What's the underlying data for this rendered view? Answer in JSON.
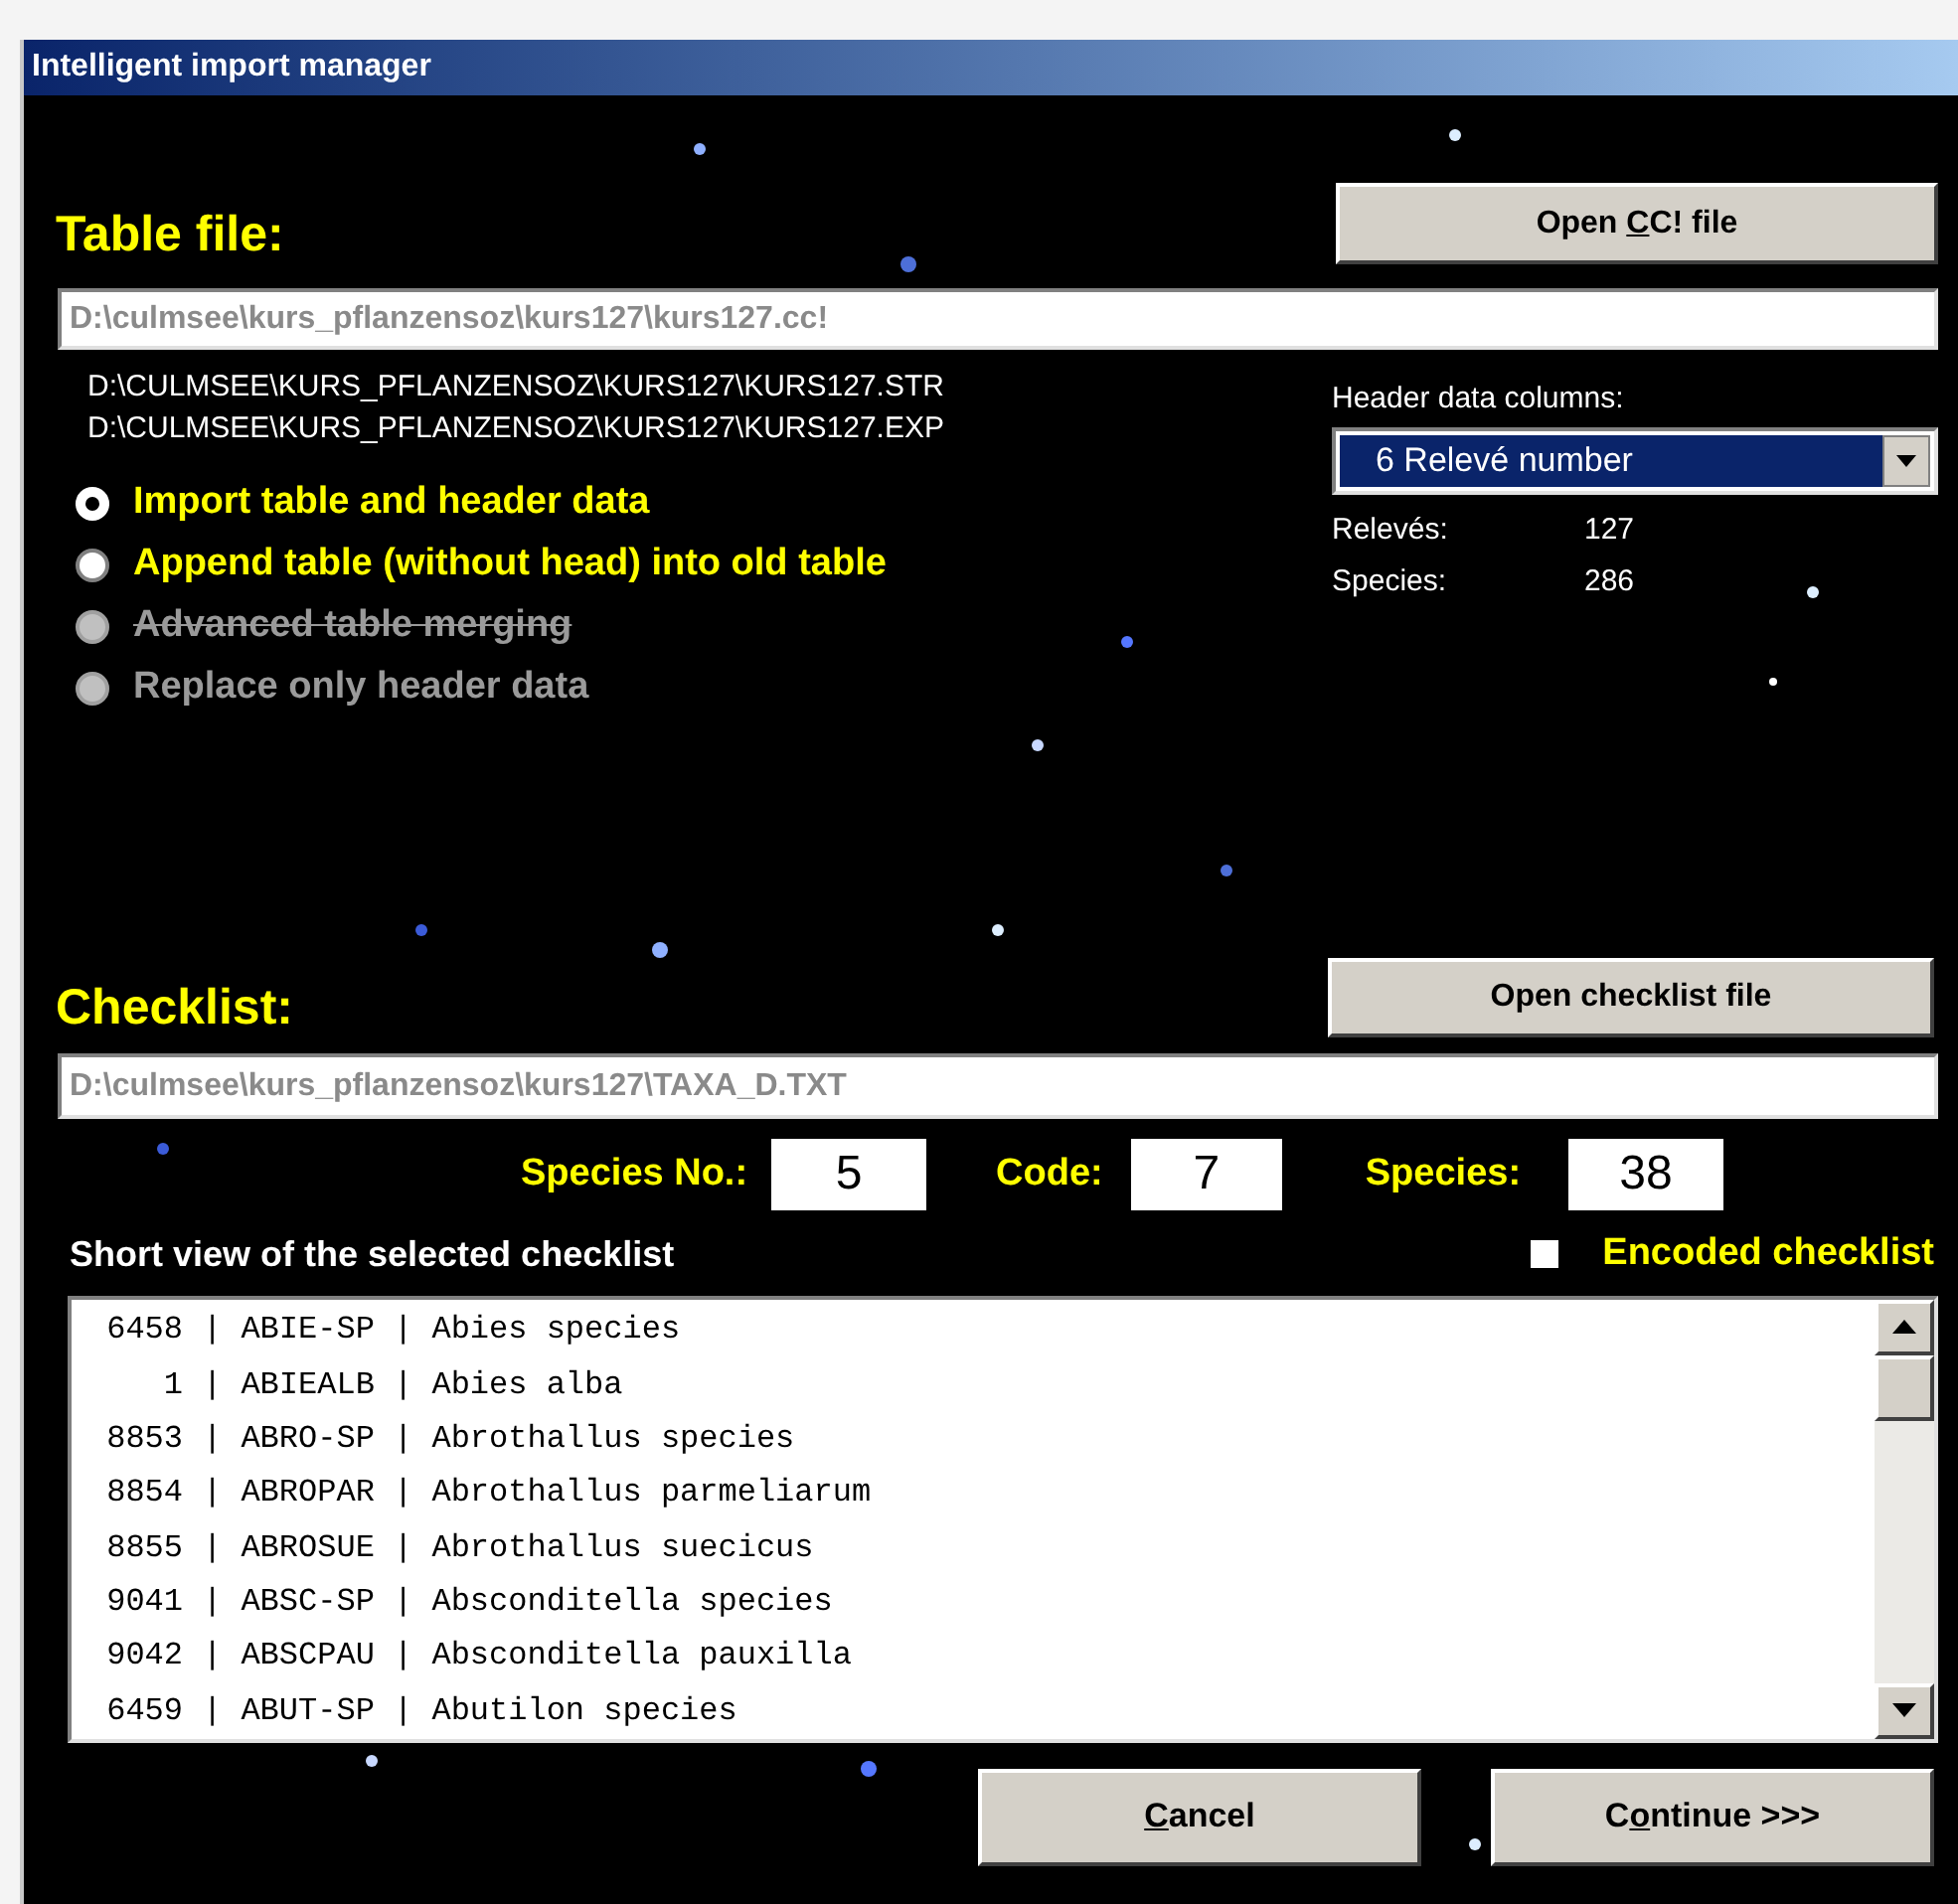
{
  "window": {
    "title": "Intelligent import manager"
  },
  "table_file": {
    "label": "Table file:",
    "open_button": {
      "pre": "Open ",
      "key": "C",
      "post": "C! file"
    },
    "path": "D:\\culmsee\\kurs_pflanzensoz\\kurs127\\kurs127.cc!",
    "files": [
      "D:\\CULMSEE\\KURS_PFLANZENSOZ\\KURS127\\KURS127.STR",
      "D:\\CULMSEE\\KURS_PFLANZENSOZ\\KURS127\\KURS127.EXP"
    ]
  },
  "import_options": [
    {
      "label": "Import table and header data",
      "selected": true,
      "disabled": false,
      "strikethrough": false
    },
    {
      "label": "Append table (without head) into old table",
      "selected": false,
      "disabled": false,
      "strikethrough": false
    },
    {
      "label": "Advanced table merging",
      "selected": false,
      "disabled": true,
      "strikethrough": true
    },
    {
      "label": "Replace only header data",
      "selected": false,
      "disabled": true,
      "strikethrough": false
    }
  ],
  "header": {
    "label": "Header data columns:",
    "dropdown_value": "6  Relevé number",
    "stats": [
      {
        "label": "Relevés:",
        "value": "127"
      },
      {
        "label": "Species:",
        "value": "286"
      }
    ]
  },
  "checklist": {
    "label": "Checklist:",
    "open_button": {
      "pre": "Open checklist file"
    },
    "path": "D:\\culmsee\\kurs_pflanzensoz\\kurs127\\TAXA_D.TXT",
    "fields": [
      {
        "label": "Species No.:",
        "value": "5"
      },
      {
        "label": "Code:",
        "value": "7"
      },
      {
        "label": "Species:",
        "value": "38"
      }
    ],
    "short_view_label": "Short view of the selected checklist",
    "encoded": {
      "label": "Encoded checklist",
      "checked": false
    },
    "rows": [
      {
        "number": "6458",
        "text": "| ABIE-SP | Abies species"
      },
      {
        "number": "1",
        "text": "| ABIEALB | Abies alba"
      },
      {
        "number": "8853",
        "text": "| ABRO-SP | Abrothallus species"
      },
      {
        "number": "8854",
        "text": "| ABROPAR | Abrothallus parmeliarum"
      },
      {
        "number": "8855",
        "text": "| ABROSUE | Abrothallus suecicus"
      },
      {
        "number": "9041",
        "text": "| ABSC-SP | Absconditella species"
      },
      {
        "number": "9042",
        "text": "| ABSCPAU | Absconditella pauxilla"
      },
      {
        "number": "6459",
        "text": "| ABUT-SP | Abutilon species"
      }
    ]
  },
  "buttons": [
    {
      "key": "C",
      "post": "ancel"
    },
    {
      "pre": "C",
      "key": "o",
      "post": "ntinue >>>"
    }
  ]
}
